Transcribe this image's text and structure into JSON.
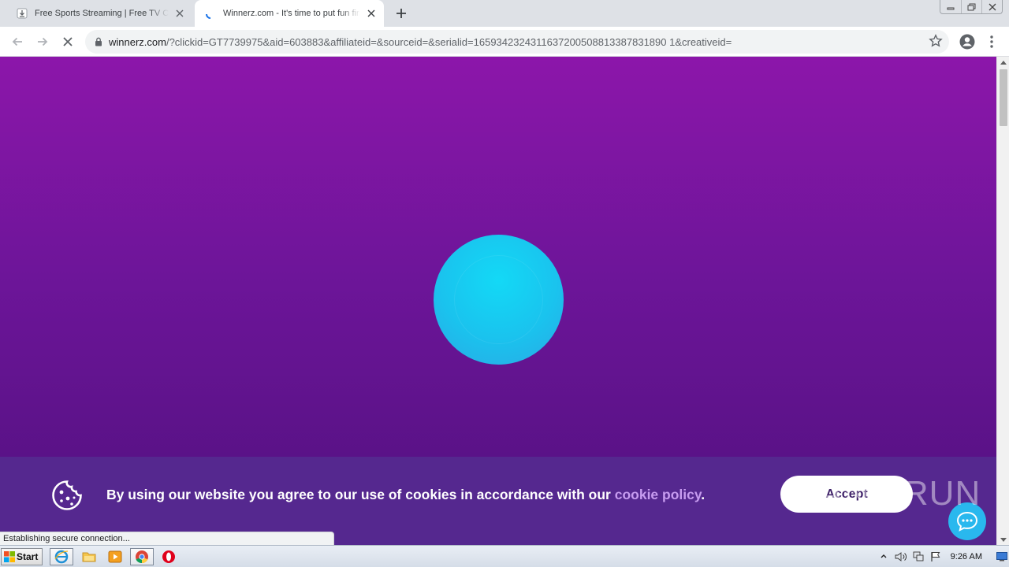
{
  "browser": {
    "tabs": [
      {
        "title": "Free Sports Streaming | Free TV Channels",
        "favicon": "download-icon",
        "active": false
      },
      {
        "title": "Winnerz.com - It's time to put fun first",
        "favicon": "loading-spinner-icon",
        "active": true
      }
    ],
    "new_tab_icon": "plus-icon",
    "window_controls": [
      "minimize-icon",
      "restore-icon",
      "close-icon"
    ],
    "toolbar": {
      "url_host": "winnerz.com",
      "url_rest": "/?clickid=GT7739975&aid=603883&affiliateid=&sourceid=&serialid=1659342324311637200508813387831890 1&creativeid=",
      "stop_icon": "stop-loading-icon",
      "bookmark_icon": "star-icon",
      "profile_icon": "account-circle-icon",
      "menu_icon": "kebab-menu-icon"
    },
    "status_text": "Establishing secure connection..."
  },
  "page": {
    "background_top": "#8c16aa",
    "background_bottom": "#51117f",
    "loader_color": "#13d9f6",
    "cookie_banner": {
      "text_before_link": "By using our website you agree to our use of cookies in accordance with our ",
      "link_text": "cookie policy",
      "text_after_link": ".",
      "accept_label": "Accept",
      "icon": "cookie-icon",
      "chat_icon": "chat-bubble-icon",
      "background": "#55288f",
      "link_color": "#c79cf0"
    },
    "watermark_text": "ANY RUN"
  },
  "taskbar": {
    "start_label": "Start",
    "pinned": [
      "internet-explorer-icon",
      "folder-icon",
      "media-player-icon",
      "chrome-icon",
      "opera-icon"
    ],
    "tray_icons": [
      "tray-expand-icon",
      "volume-icon",
      "network-icon",
      "flag-icon"
    ],
    "clock": "9:26 AM"
  }
}
